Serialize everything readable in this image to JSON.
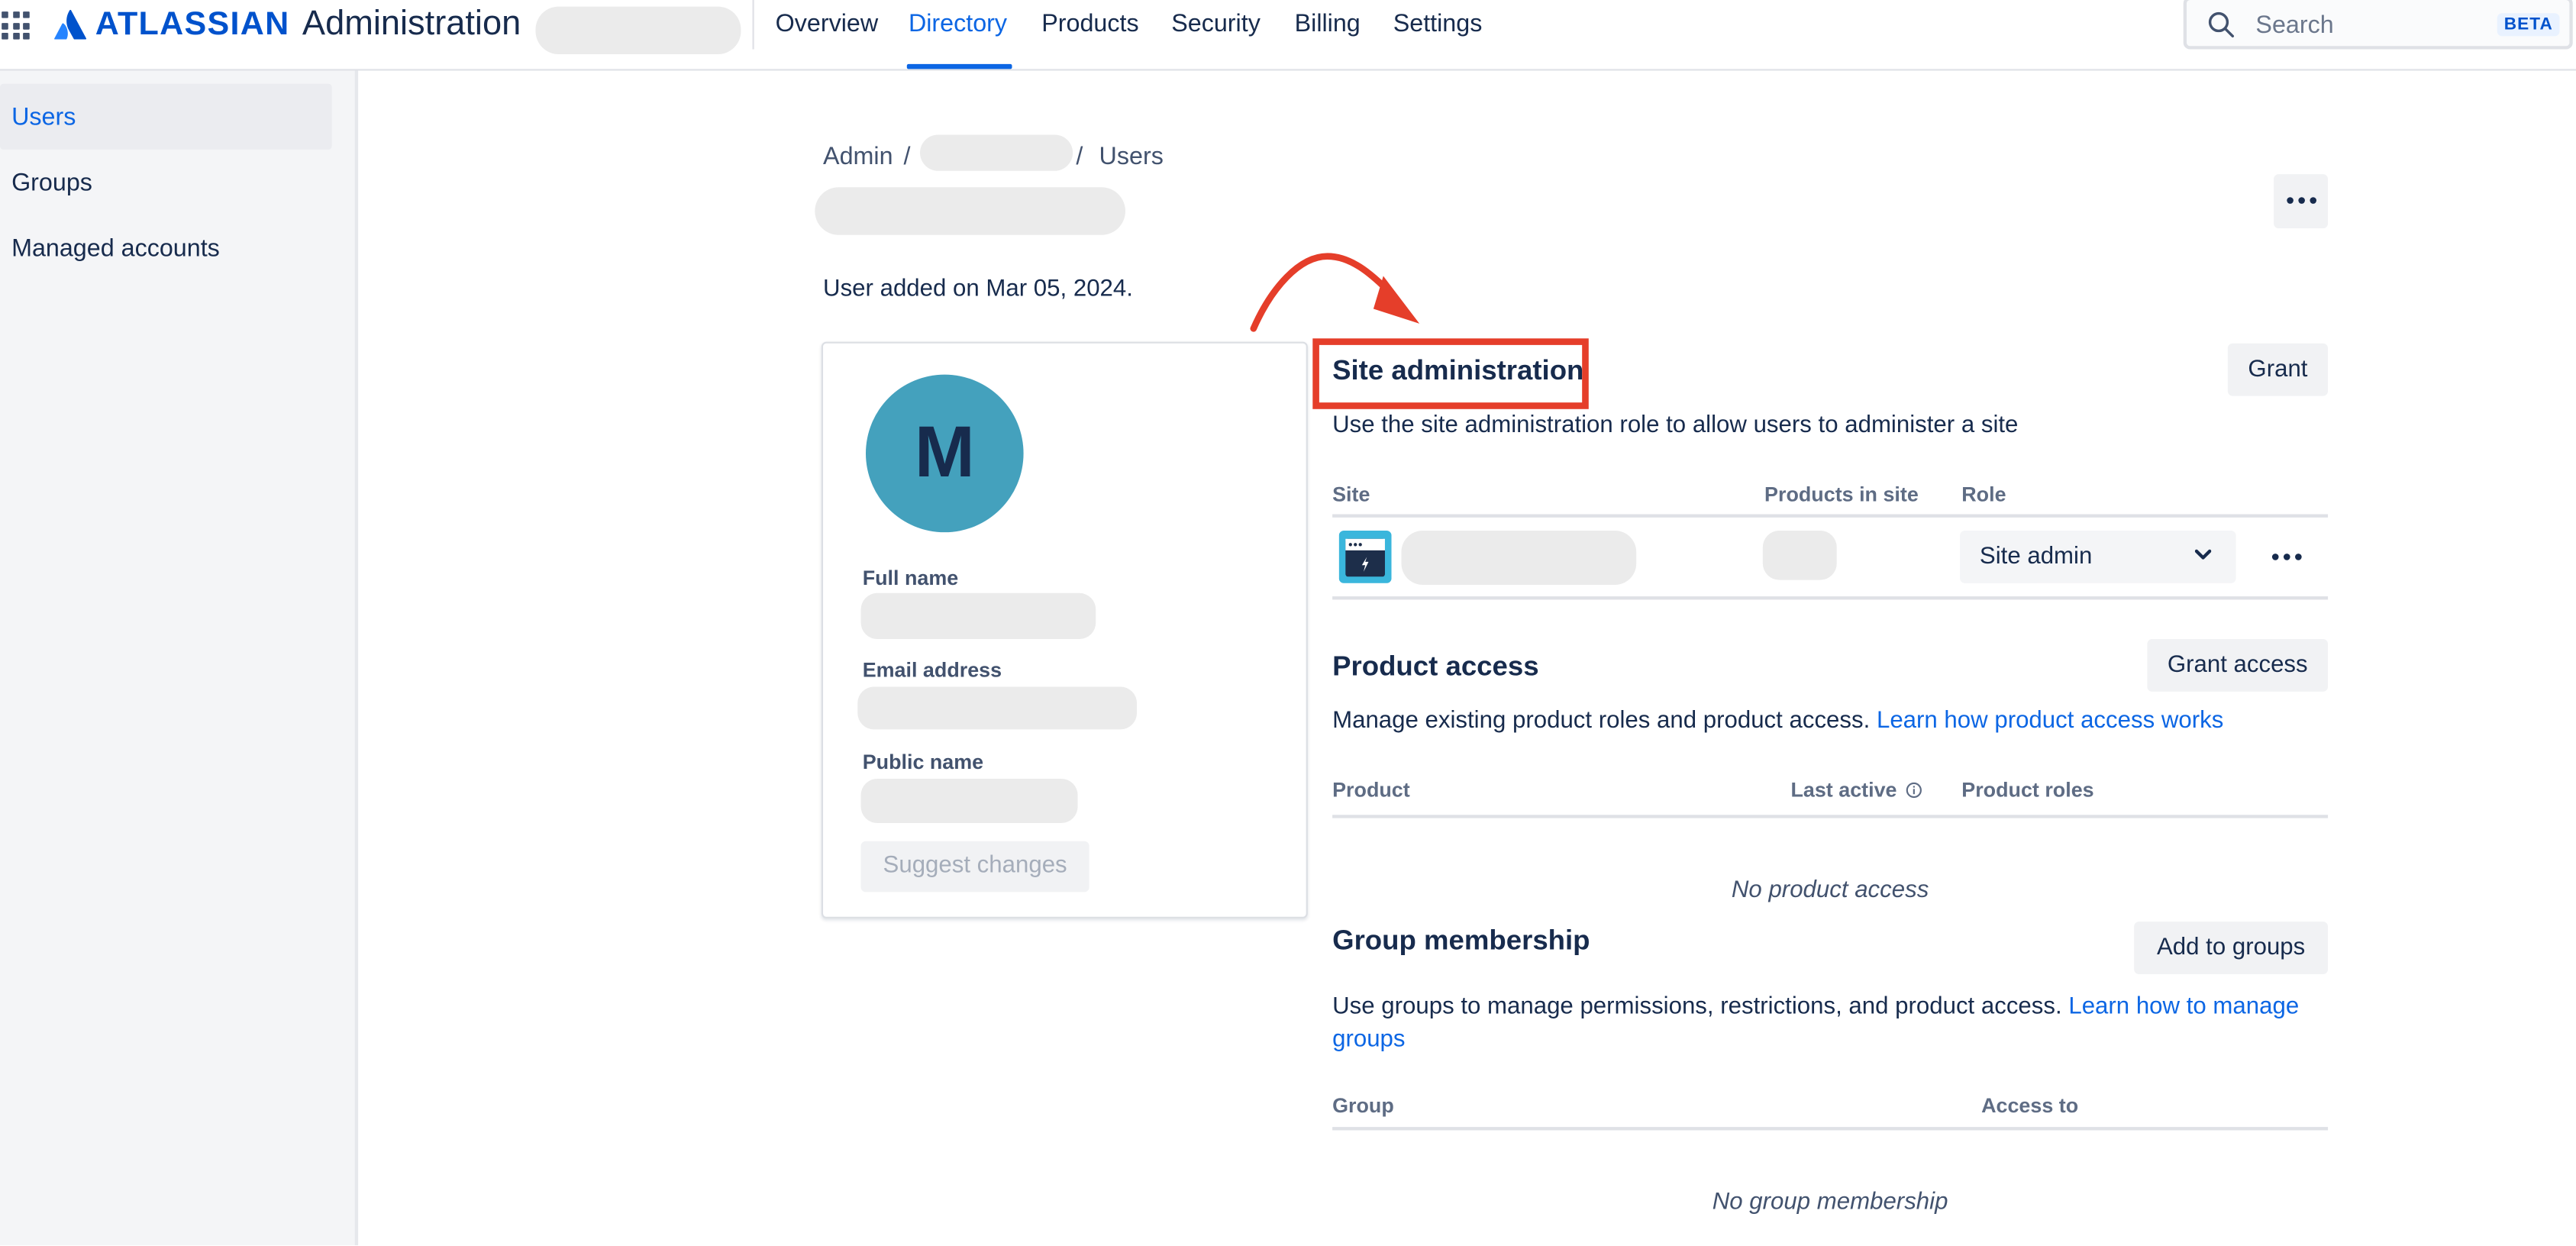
{
  "header": {
    "brand": "ATLASSIAN",
    "app_title": "Administration",
    "nav": [
      {
        "label": "Overview"
      },
      {
        "label": "Directory"
      },
      {
        "label": "Products"
      },
      {
        "label": "Security"
      },
      {
        "label": "Billing"
      },
      {
        "label": "Settings"
      }
    ],
    "active_nav": "Directory",
    "search": {
      "placeholder": "Search",
      "badge": "BETA"
    }
  },
  "sidebar": {
    "items": [
      {
        "label": "Users"
      },
      {
        "label": "Groups"
      },
      {
        "label": "Managed accounts"
      }
    ],
    "active_item": "Users"
  },
  "breadcrumb": {
    "items": [
      "Admin",
      "Users"
    ],
    "separator": "/"
  },
  "user": {
    "added_text": "User added on Mar 05, 2024.",
    "avatar_initial": "M",
    "avatar_color": "#44a1bd"
  },
  "profile": {
    "full_name_label": "Full name",
    "email_label": "Email address",
    "public_name_label": "Public name",
    "suggest_button": "Suggest changes"
  },
  "site_admin": {
    "title": "Site administration",
    "grant_button": "Grant",
    "description": "Use the site administration role to allow users to administer a site",
    "columns": [
      "Site",
      "Products in site",
      "Role"
    ],
    "rows": [
      {
        "role": "Site admin"
      }
    ]
  },
  "product_access": {
    "title": "Product access",
    "grant_button": "Grant access",
    "description": "Manage existing product roles and product access.",
    "link": "Learn how product access works",
    "columns": [
      "Product",
      "Last active",
      "Product roles"
    ],
    "empty_text": "No product access"
  },
  "group_membership": {
    "title": "Group membership",
    "add_button": "Add to groups",
    "description": "Use groups to manage permissions, restrictions, and product access.",
    "link": "Learn how to manage groups",
    "columns": [
      "Group",
      "Access to"
    ],
    "empty_text": "No group membership"
  },
  "colors": {
    "accent": "#0c66e4",
    "annotation": "#e53e2a"
  },
  "icons": [
    "app-switcher-icon",
    "atlassian-logo-icon",
    "search-icon",
    "more-icon",
    "chevron-down-icon",
    "info-icon",
    "site-icon",
    "annotation-arrow-icon"
  ]
}
